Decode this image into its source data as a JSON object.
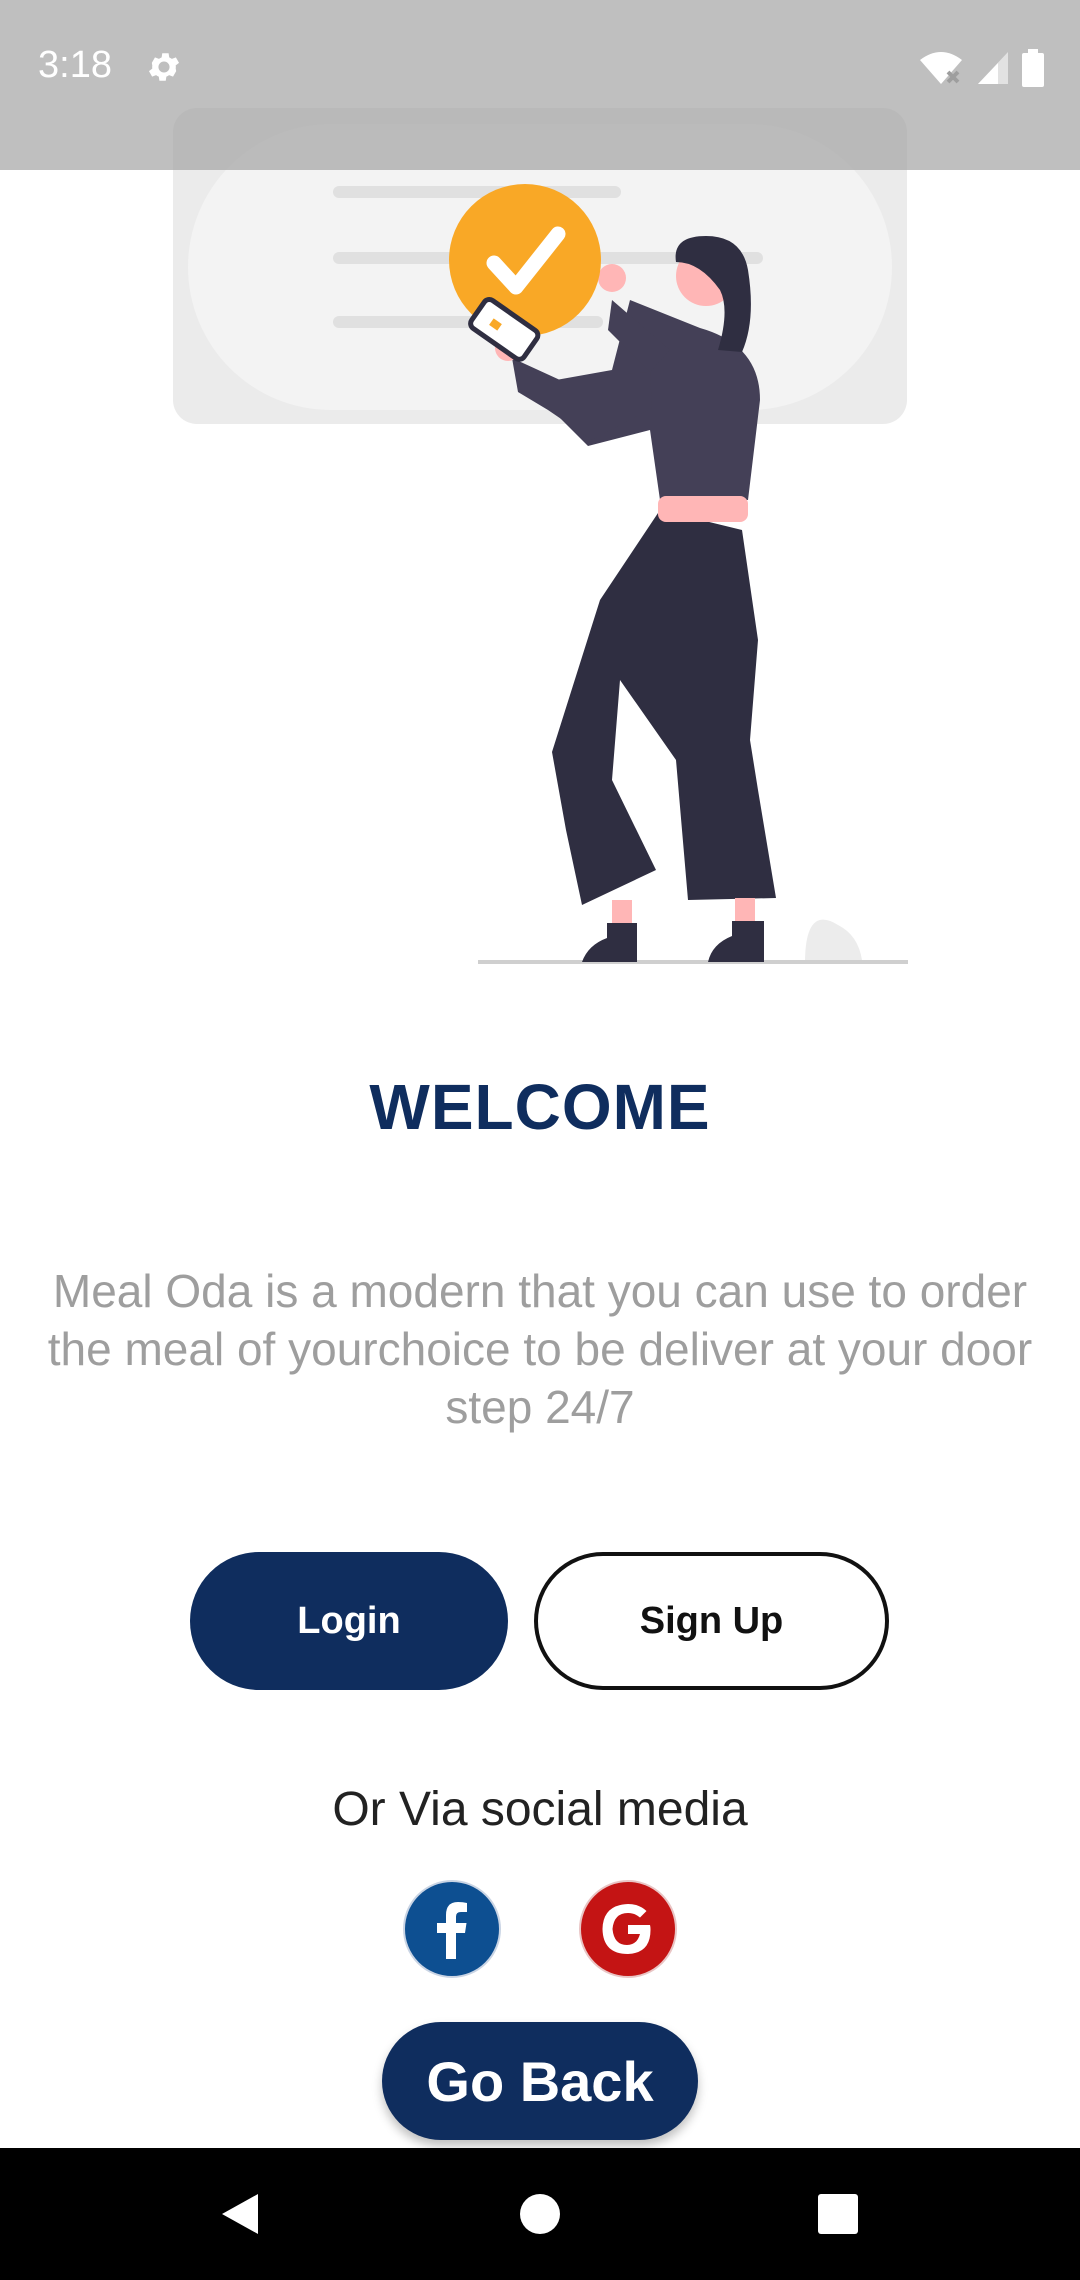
{
  "status_bar": {
    "time": "3:18",
    "icons": [
      "settings-icon",
      "wifi-icon",
      "signal-icon",
      "battery-icon"
    ]
  },
  "illustration": {
    "icons": [
      "checkmark-icon",
      "phone-icon"
    ],
    "colors": {
      "accent": "#f9a826",
      "figure": "#2f2e41",
      "skin": "#ffb6b6",
      "card": "#ebebeb"
    }
  },
  "main": {
    "title": "WELCOME",
    "description": "Meal Oda is a modern that you can use to order the meal of yourchoice to be deliver at your door step 24/7",
    "login_label": "Login",
    "signup_label": "Sign Up",
    "social_caption": "Or Via social media",
    "social_buttons": [
      "facebook-icon",
      "google-icon"
    ],
    "go_back_label": "Go Back"
  },
  "nav_bar": {
    "icons": [
      "back-icon",
      "home-icon",
      "recents-icon"
    ]
  },
  "colors": {
    "primary": "#0f2d5e",
    "facebook": "#0d4f91",
    "google": "#c41414",
    "description_text": "#9e9e9e"
  }
}
